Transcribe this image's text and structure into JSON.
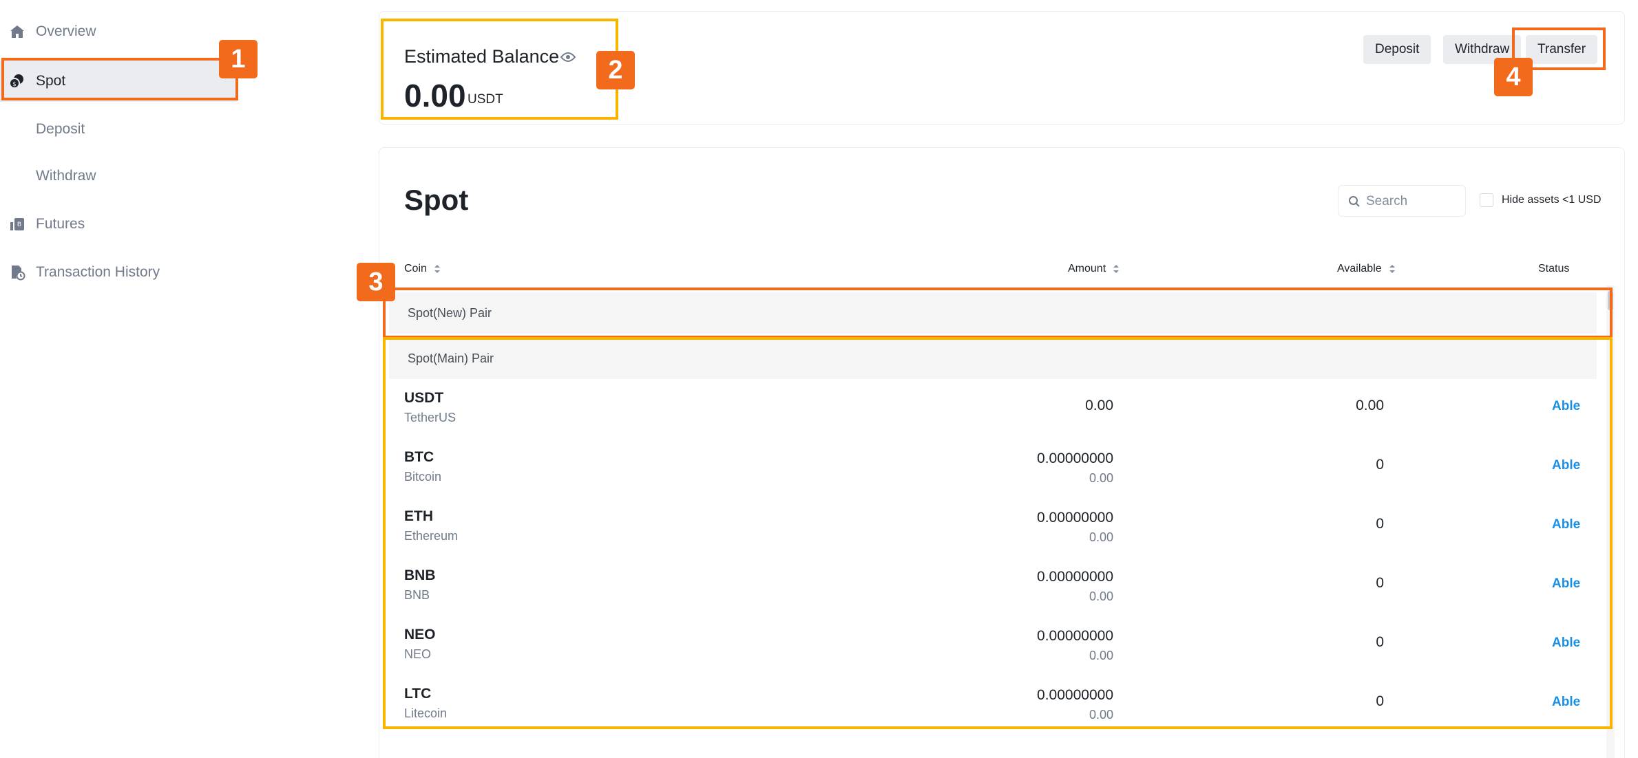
{
  "sidebar": {
    "items": [
      {
        "label": "Overview",
        "icon": "home-icon"
      },
      {
        "label": "Spot",
        "icon": "spot-wallet-icon",
        "active": true
      },
      {
        "label": "Deposit",
        "icon": ""
      },
      {
        "label": "Withdraw",
        "icon": ""
      },
      {
        "label": "Futures",
        "icon": "futures-icon"
      },
      {
        "label": "Transaction History",
        "icon": "history-icon"
      }
    ]
  },
  "annotations": {
    "b1": "1",
    "b2": "2",
    "b3": "3",
    "b4": "4"
  },
  "balance": {
    "title": "Estimated Balance",
    "amount": "0.00",
    "unit": "USDT",
    "deposit_label": "Deposit",
    "withdraw_label": "Withdraw",
    "transfer_label": "Transfer"
  },
  "spot": {
    "title": "Spot",
    "search_placeholder": "Search",
    "hide_small_label": "Hide assets <1 USD",
    "columns": {
      "coin": "Coin",
      "amount": "Amount",
      "available": "Available",
      "status": "Status"
    },
    "groups": {
      "new": "Spot(New) Pair",
      "main": "Spot(Main) Pair"
    },
    "rows": [
      {
        "symbol": "USDT",
        "name": "TetherUS",
        "amount": "0.00",
        "amount_sub": "",
        "available": "0.00",
        "status": "Able"
      },
      {
        "symbol": "BTC",
        "name": "Bitcoin",
        "amount": "0.00000000",
        "amount_sub": "0.00",
        "available": "0",
        "status": "Able"
      },
      {
        "symbol": "ETH",
        "name": "Ethereum",
        "amount": "0.00000000",
        "amount_sub": "0.00",
        "available": "0",
        "status": "Able"
      },
      {
        "symbol": "BNB",
        "name": "BNB",
        "amount": "0.00000000",
        "amount_sub": "0.00",
        "available": "0",
        "status": "Able"
      },
      {
        "symbol": "NEO",
        "name": "NEO",
        "amount": "0.00000000",
        "amount_sub": "0.00",
        "available": "0",
        "status": "Able"
      },
      {
        "symbol": "LTC",
        "name": "Litecoin",
        "amount": "0.00000000",
        "amount_sub": "0.00",
        "available": "0",
        "status": "Able"
      }
    ]
  },
  "colors": {
    "highlight_inner": "#f7b500",
    "highlight_outer": "#f26a1b",
    "link": "#1a8fe3"
  }
}
